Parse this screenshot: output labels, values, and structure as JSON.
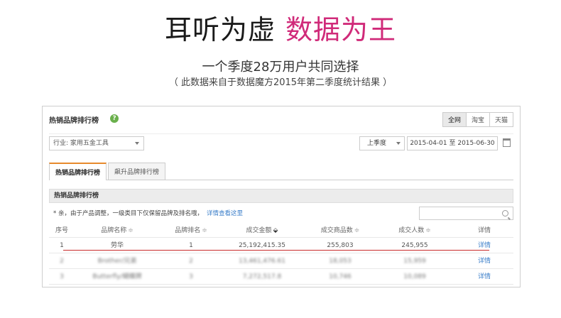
{
  "headline": {
    "part1": "耳听为虚",
    "part2": "数据为王"
  },
  "subheadline": "一个季度28万用户共同选择",
  "source_note": "（ 此数据来自于数据魔方2015年第二季度统计结果 ）",
  "colors": {
    "accent_pink": "#d02a79",
    "link_blue": "#3a7ec9",
    "highlight_red": "#c92a2a",
    "tab_accent": "#e78a2c"
  },
  "panel": {
    "title": "热销品牌排行榜",
    "platform_tabs": [
      "全网",
      "淘宝",
      "天猫"
    ],
    "industry_select": "行业: 家用五金工具",
    "period_select": "上季度",
    "date_range": "2015-04-01 至 2015-06-30",
    "tabs": [
      "热销品牌排行榜",
      "飙升品牌排行榜"
    ],
    "table_title": "热销品牌排行榜",
    "tip": "* 亲，由于产品调整，一级类目下仅保留品牌及排名哦，",
    "tip_link": "详情查看这里",
    "columns": [
      "序号",
      "品牌名称",
      "品牌排名",
      "成交金额",
      "成交商品数",
      "成交人数",
      "详情"
    ],
    "rows": [
      {
        "idx": "1",
        "brand": "劳华",
        "rank": "1",
        "amount": "25,192,415.35",
        "items": "255,803",
        "buyers": "245,955",
        "detail": "详情"
      },
      {
        "idx": "2",
        "brand": "Brother/兄弟",
        "rank": "2",
        "amount": "13,461,476.61",
        "items": "18,053",
        "buyers": "15,959",
        "detail": "详情"
      },
      {
        "idx": "3",
        "brand": "Butterfly/蝴蝶牌",
        "rank": "3",
        "amount": "7,272,517.8",
        "items": "10,746",
        "buyers": "10,089",
        "detail": "详情"
      }
    ]
  }
}
